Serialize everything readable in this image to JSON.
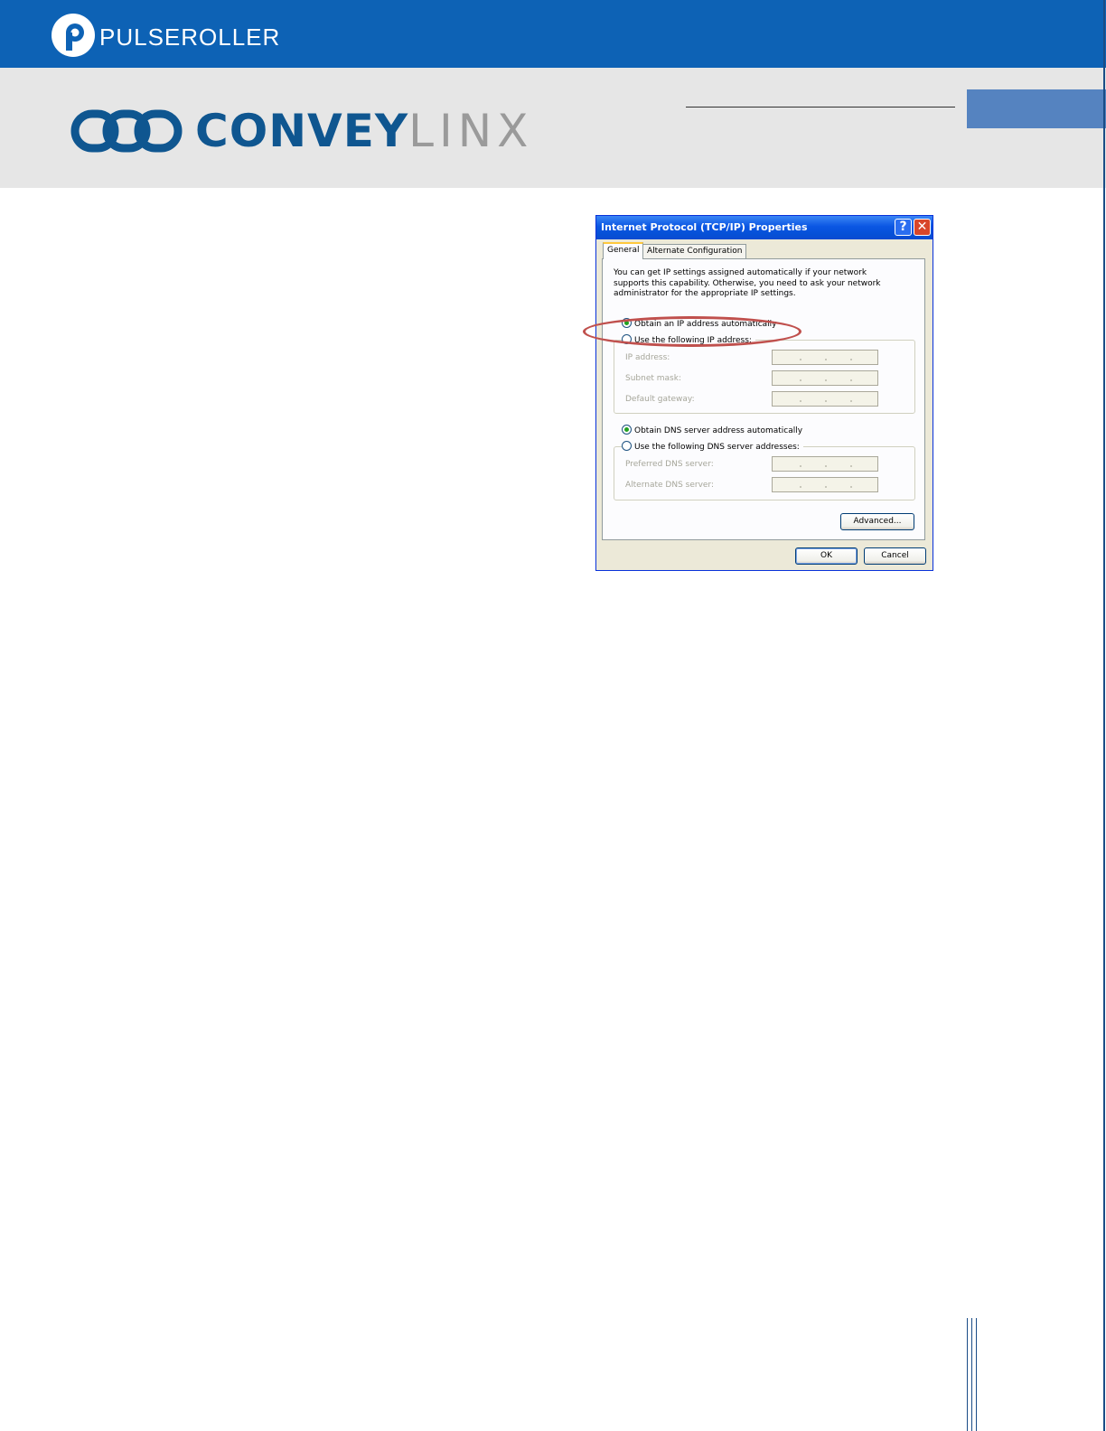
{
  "header": {
    "brand": "PULSEROLLER",
    "product_main": "CONVEY",
    "product_accent": "LINX",
    "colors": {
      "topbar": "#0d62b5",
      "band": "#e6e6e6",
      "accent_tab": "#5583c0",
      "product_dark": "#0f5690",
      "product_light": "#9a9a9a"
    }
  },
  "dialog": {
    "title": "Internet Protocol (TCP/IP) Properties",
    "help_glyph": "?",
    "close_glyph": "✕",
    "tabs": [
      "General",
      "Alternate Configuration"
    ],
    "active_tab": "General",
    "intro": "You can get IP settings assigned automatically if your network supports this capability. Otherwise, you need to ask your network administrator for the appropriate IP settings.",
    "ip_options": {
      "auto": "Obtain an IP address automatically",
      "manual": "Use the following IP address:",
      "selected": "auto"
    },
    "ip_fields": {
      "ip_address": "IP address:",
      "subnet_mask": "Subnet mask:",
      "default_gateway": "Default gateway:"
    },
    "dns_options": {
      "auto": "Obtain DNS server address automatically",
      "manual": "Use the following DNS server addresses:",
      "selected": "auto"
    },
    "dns_fields": {
      "preferred": "Preferred DNS server:",
      "alternate": "Alternate DNS server:"
    },
    "buttons": {
      "advanced": "Advanced...",
      "ok": "OK",
      "cancel": "Cancel"
    },
    "highlight_color": "#c0504d"
  }
}
